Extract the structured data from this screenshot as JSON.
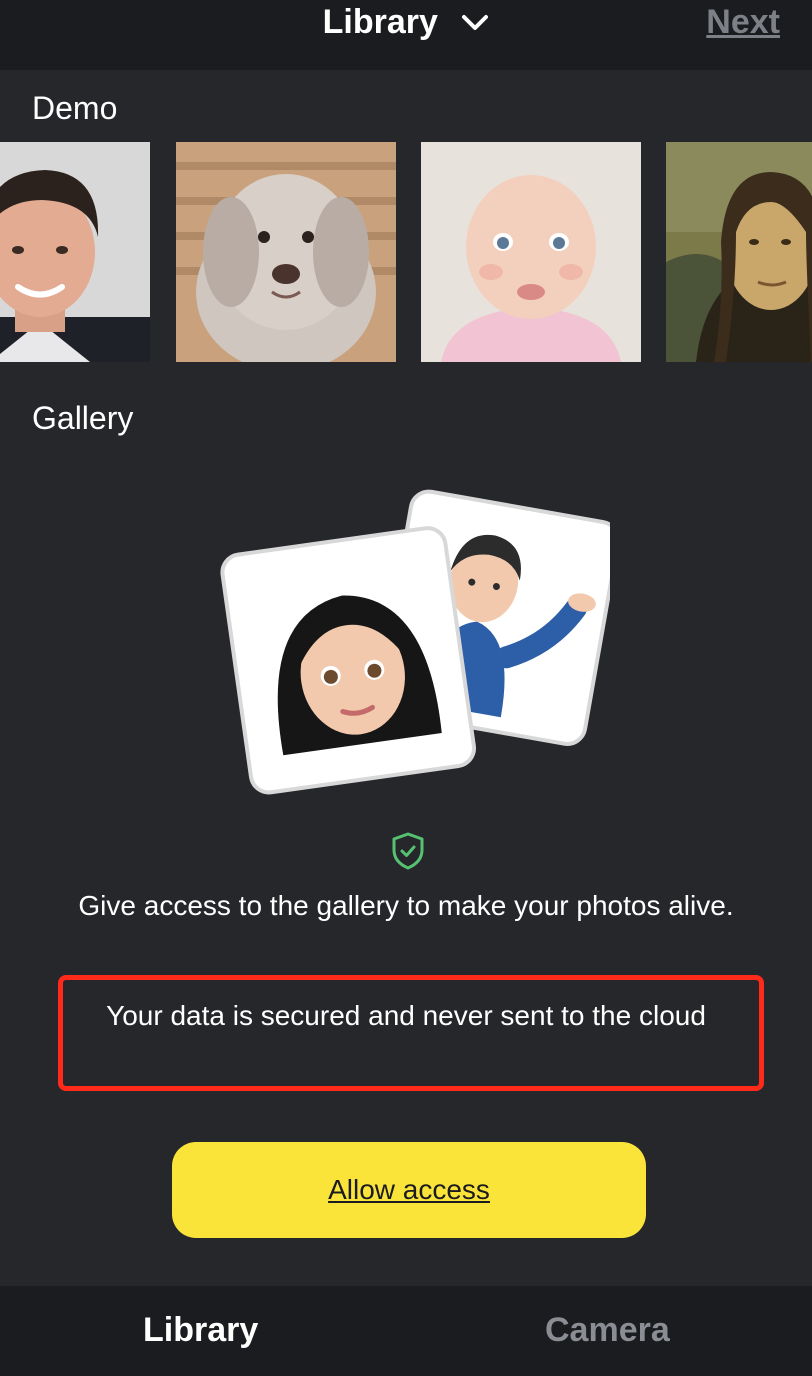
{
  "header": {
    "title": "Library",
    "next_label": "Next"
  },
  "demo": {
    "label": "Demo",
    "items": [
      {
        "name": "man-portrait"
      },
      {
        "name": "dog-portrait"
      },
      {
        "name": "baby-portrait"
      },
      {
        "name": "mona-lisa-portrait"
      }
    ]
  },
  "gallery": {
    "label": "Gallery",
    "illustration": "woman-and-man-emoji-cards",
    "shield_icon": "shield-check-icon",
    "access_message": "Give access to the gallery to make your photos alive.",
    "secure_message": "Your data is secured and never sent to the cloud",
    "allow_button": "Allow access"
  },
  "tabs": [
    {
      "label": "Library",
      "active": true
    },
    {
      "label": "Camera",
      "active": false
    }
  ],
  "colors": {
    "background": "#25272b",
    "bars": "#1b1c1f",
    "accent_button": "#fbe43a",
    "highlight_box": "#ff2a1a",
    "shield": "#56c271",
    "inactive_text": "#8a8d93"
  }
}
